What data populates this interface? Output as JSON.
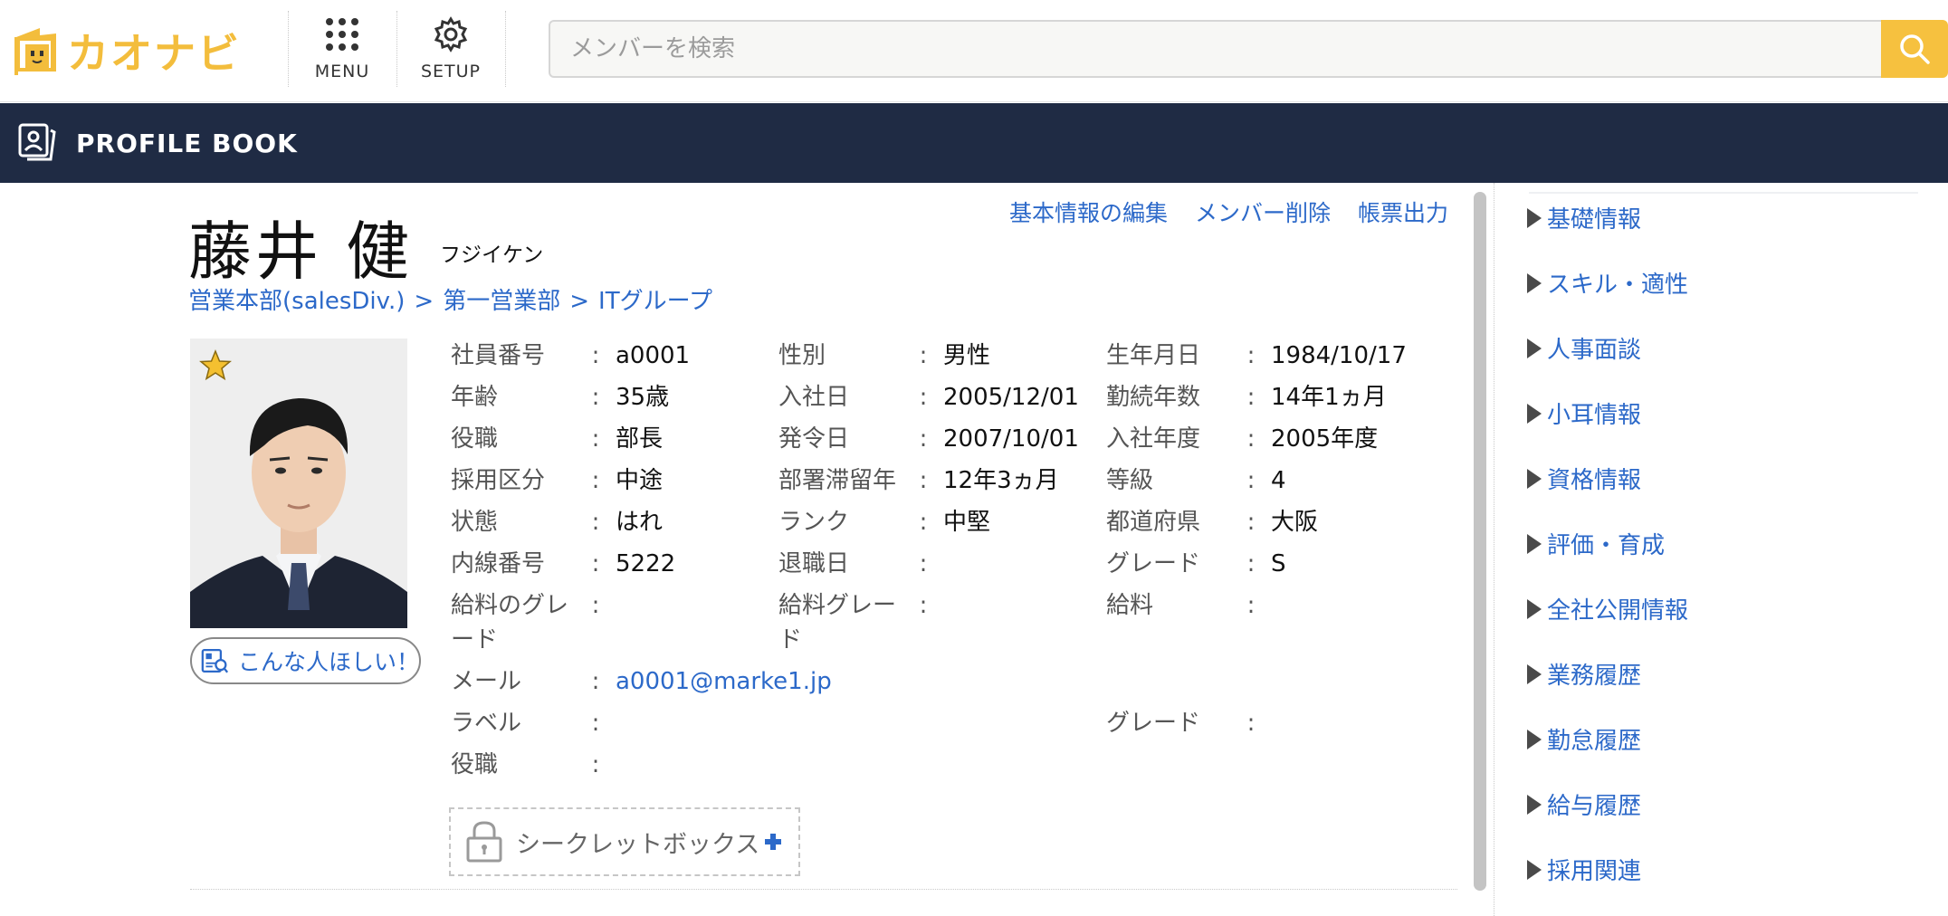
{
  "header": {
    "logo_text": "カオナビ",
    "menu_label": "MENU",
    "setup_label": "SETUP",
    "search": {
      "placeholder": "メンバーを検索",
      "value": ""
    },
    "accent_color": "#f6c13f"
  },
  "titlebar": {
    "title": "PROFILE BOOK",
    "bg_color": "#1f2b44"
  },
  "profile": {
    "name": "藤井 健",
    "kana": "フジイケン",
    "actions": [
      "基本情報の編集",
      "メンバー削除",
      "帳票出力"
    ],
    "breadcrumb": [
      "営業本部(salesDiv.)",
      "第一営業部",
      "ITグループ"
    ],
    "breadcrumb_sep": ">",
    "wish_button": "こんな人ほしい！",
    "secret_box": "シークレットボックス",
    "colon": ":",
    "fields": {
      "employee_no": {
        "label": "社員番号",
        "value": "a0001"
      },
      "gender": {
        "label": "性別",
        "value": "男性"
      },
      "birthday": {
        "label": "生年月日",
        "value": "1984/10/17"
      },
      "age": {
        "label": "年齢",
        "value": "35歳"
      },
      "hire_date": {
        "label": "入社日",
        "value": "2005/12/01"
      },
      "tenure": {
        "label": "勤続年数",
        "value": "14年1ヵ月"
      },
      "position": {
        "label": "役職",
        "value": "部長"
      },
      "appointment_date": {
        "label": "発令日",
        "value": "2007/10/01"
      },
      "hire_year": {
        "label": "入社年度",
        "value": "2005年度"
      },
      "hire_type": {
        "label": "採用区分",
        "value": "中途"
      },
      "dept_stay": {
        "label": "部署滞留年",
        "value": "12年3ヵ月"
      },
      "level": {
        "label": "等級",
        "value": "4"
      },
      "status": {
        "label": "状態",
        "value": "はれ"
      },
      "rank": {
        "label": "ランク",
        "value": "中堅"
      },
      "prefecture": {
        "label": "都道府県",
        "value": "大阪"
      },
      "extension": {
        "label": "内線番号",
        "value": "5222"
      },
      "retire_date": {
        "label": "退職日",
        "value": ""
      },
      "grade": {
        "label": "グレード",
        "value": "S"
      },
      "salary_grade_1": {
        "label": "給料のグレード",
        "value": ""
      },
      "salary_grade_2": {
        "label": "給料グレード",
        "value": ""
      },
      "salary": {
        "label": "給料",
        "value": ""
      },
      "mail": {
        "label": "メール",
        "value": "a0001@marke1.jp"
      },
      "label": {
        "label": "ラベル",
        "value": ""
      },
      "grade2": {
        "label": "グレード",
        "value": ""
      },
      "position2": {
        "label": "役職",
        "value": ""
      }
    }
  },
  "sidenav": {
    "items": [
      "基礎情報",
      "スキル・適性",
      "人事面談",
      "小耳情報",
      "資格情報",
      "評価・育成",
      "全社公開情報",
      "業務履歴",
      "勤怠履歴",
      "給与履歴",
      "採用関連"
    ]
  }
}
